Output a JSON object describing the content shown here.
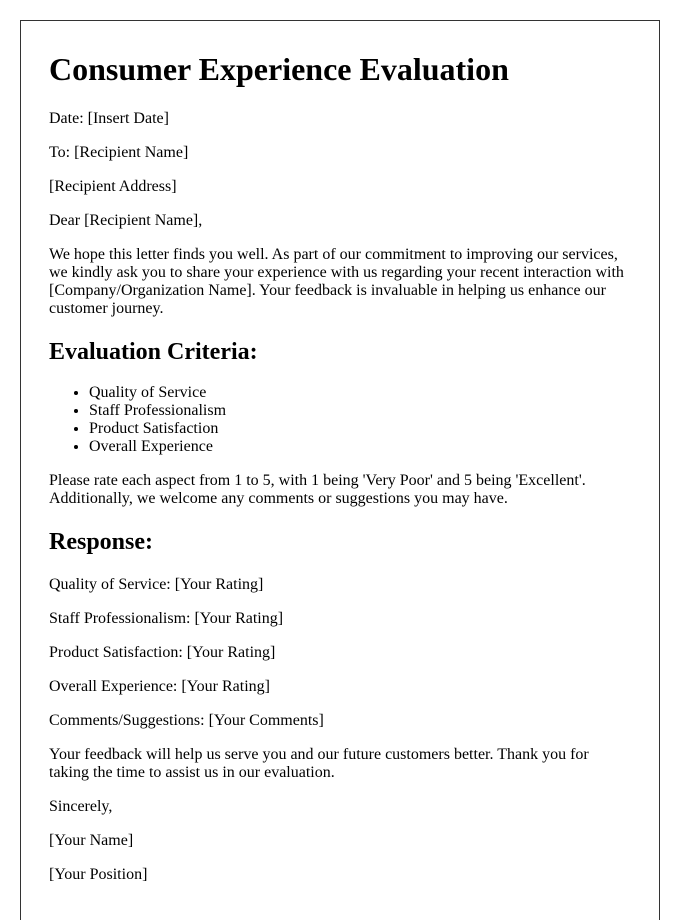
{
  "title": "Consumer Experience Evaluation",
  "header": {
    "date": "Date: [Insert Date]",
    "to": "To: [Recipient Name]",
    "address": "[Recipient Address]",
    "salutation": "Dear [Recipient Name],"
  },
  "intro": "We hope this letter finds you well. As part of our commitment to improving our services, we kindly ask you to share your experience with us regarding your recent interaction with [Company/Organization Name]. Your feedback is invaluable in helping us enhance our customer journey.",
  "criteria": {
    "heading": "Evaluation Criteria:",
    "items": [
      "Quality of Service",
      "Staff Professionalism",
      "Product Satisfaction",
      "Overall Experience"
    ],
    "instructions": "Please rate each aspect from 1 to 5, with 1 being 'Very Poor' and 5 being 'Excellent'. Additionally, we welcome any comments or suggestions you may have."
  },
  "response": {
    "heading": "Response:",
    "lines": [
      "Quality of Service: [Your Rating]",
      "Staff Professionalism: [Your Rating]",
      "Product Satisfaction: [Your Rating]",
      "Overall Experience: [Your Rating]",
      "Comments/Suggestions: [Your Comments]"
    ]
  },
  "closing": {
    "thanks": "Your feedback will help us serve you and our future customers better. Thank you for taking the time to assist us in our evaluation.",
    "signoff": "Sincerely,",
    "name": "[Your Name]",
    "position": "[Your Position]"
  }
}
